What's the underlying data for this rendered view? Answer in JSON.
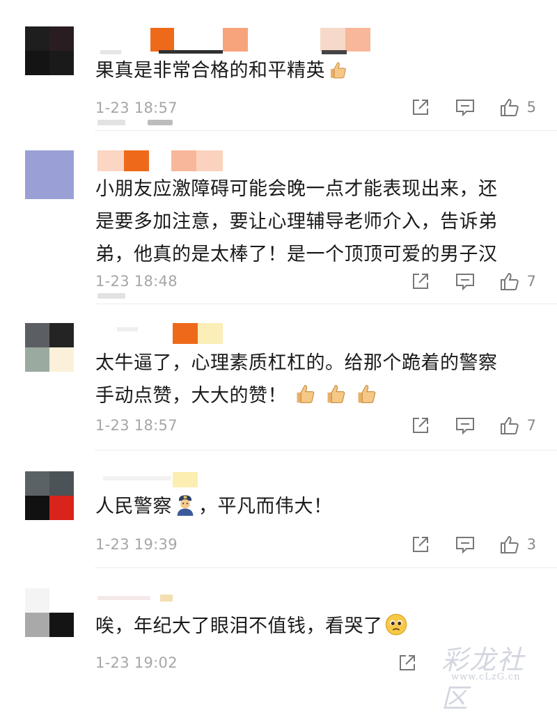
{
  "comments": [
    {
      "text": "果真是非常合格的和平精英",
      "emoji": "thumbs-up",
      "time": "1-23 18:57",
      "likes": "5"
    },
    {
      "text": "小朋友应激障碍可能会晚一点才能表现出来，还\n是要多加注意，要让心理辅导老师介入，告诉弟\n弟，他真的是太棒了！是一个顶顶可爱的男子汉",
      "emoji": "",
      "time": "1-23 18:48",
      "likes": "7"
    },
    {
      "text": "太牛逼了，心理素质杠杠的。给那个跪着的警察\n手动点赞，大大的赞！",
      "emoji": "thumbs-up-x3",
      "time": "1-23 18:57",
      "likes": "7"
    },
    {
      "text": "人民警察",
      "text2": "，平凡而伟大！",
      "emoji": "police-officer",
      "time": "1-23 19:39",
      "likes": "3"
    },
    {
      "text": "唉，年纪大了眼泪不值钱，看哭了",
      "emoji": "pleading-face",
      "time": "1-23 19:02",
      "likes": ""
    }
  ],
  "actions": {
    "share_icon": "share-icon",
    "reply_icon": "comment-icon",
    "like_icon": "thumbs-up-icon"
  },
  "watermark": {
    "main": "彩龙社区",
    "sub": "www.cLzG.cn"
  }
}
